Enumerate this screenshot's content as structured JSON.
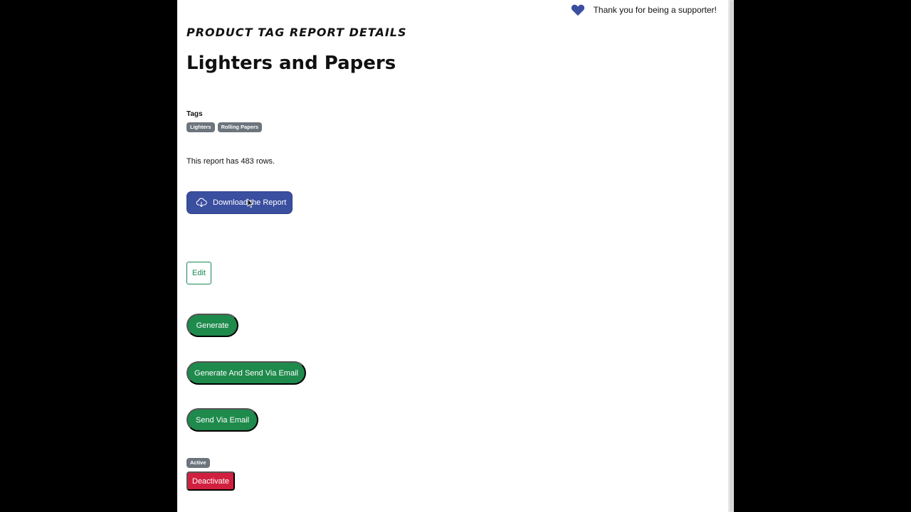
{
  "supporter": {
    "text": "Thank you for being a supporter!",
    "icon": "heart-icon",
    "icon_color": "#3b4fa0"
  },
  "header": {
    "eyebrow": "PRODUCT TAG REPORT DETAILS",
    "title": "Lighters and Papers"
  },
  "tags": {
    "label": "Tags",
    "items": [
      "Lighters",
      "Rolling Papers"
    ]
  },
  "report": {
    "rows_text": "This report has 483 rows."
  },
  "actions": {
    "download_label": "Download the Report",
    "download_icon": "cloud-download-icon",
    "edit_label": "Edit",
    "generate_label": "Generate",
    "generate_send_label": "Generate And Send Via Email",
    "send_label": "Send Via Email"
  },
  "status": {
    "badge": "Active",
    "deactivate_label": "Deactivate"
  },
  "colors": {
    "primary": "#3b4fa0",
    "success": "#1e8a4c",
    "danger": "#d1203f",
    "badge": "#6c757d"
  }
}
